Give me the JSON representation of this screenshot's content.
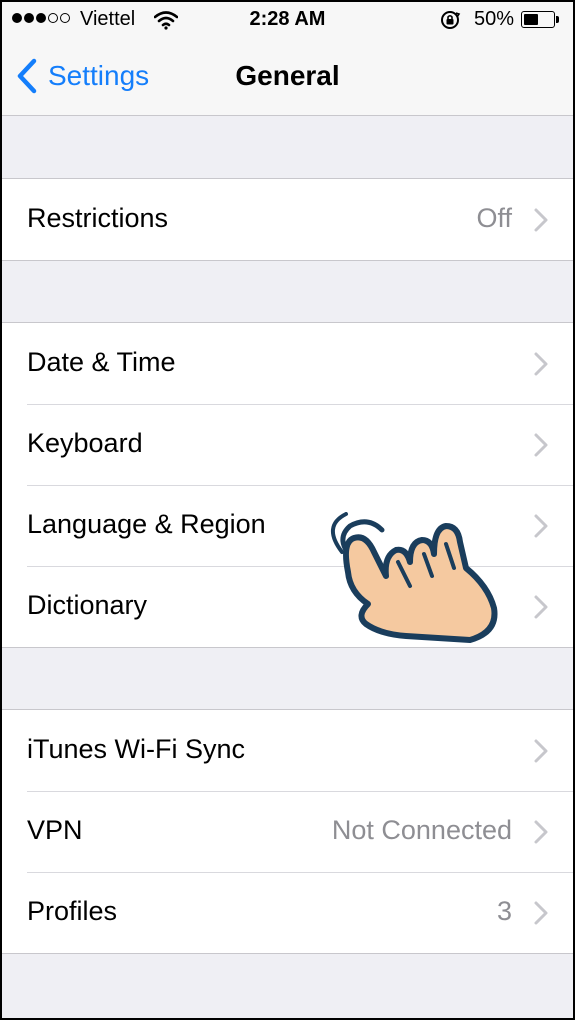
{
  "status_bar": {
    "carrier": "Viettel",
    "signal_bars": 3,
    "signal_total": 5,
    "time": "2:28 AM",
    "battery": "50%",
    "battery_level": 0.5
  },
  "nav": {
    "back_label": "Settings",
    "title": "General"
  },
  "groups": [
    {
      "rows": [
        {
          "label": "Restrictions",
          "value": "Off"
        }
      ]
    },
    {
      "rows": [
        {
          "label": "Date & Time",
          "value": ""
        },
        {
          "label": "Keyboard",
          "value": ""
        },
        {
          "label": "Language & Region",
          "value": ""
        },
        {
          "label": "Dictionary",
          "value": ""
        }
      ]
    },
    {
      "rows": [
        {
          "label": "iTunes Wi-Fi Sync",
          "value": ""
        },
        {
          "label": "VPN",
          "value": "Not Connected"
        },
        {
          "label": "Profiles",
          "value": "3"
        }
      ]
    }
  ],
  "colors": {
    "accent": "#147efb",
    "background": "#efeff4",
    "secondary_text": "#8e8e93",
    "hand_fill": "#f5c9a0",
    "hand_outline": "#1a3d5c"
  },
  "icons": [
    "wifi-icon",
    "rotation-lock-icon",
    "battery-icon",
    "back-chevron-icon",
    "chevron-right-icon",
    "tap-hand-icon"
  ]
}
